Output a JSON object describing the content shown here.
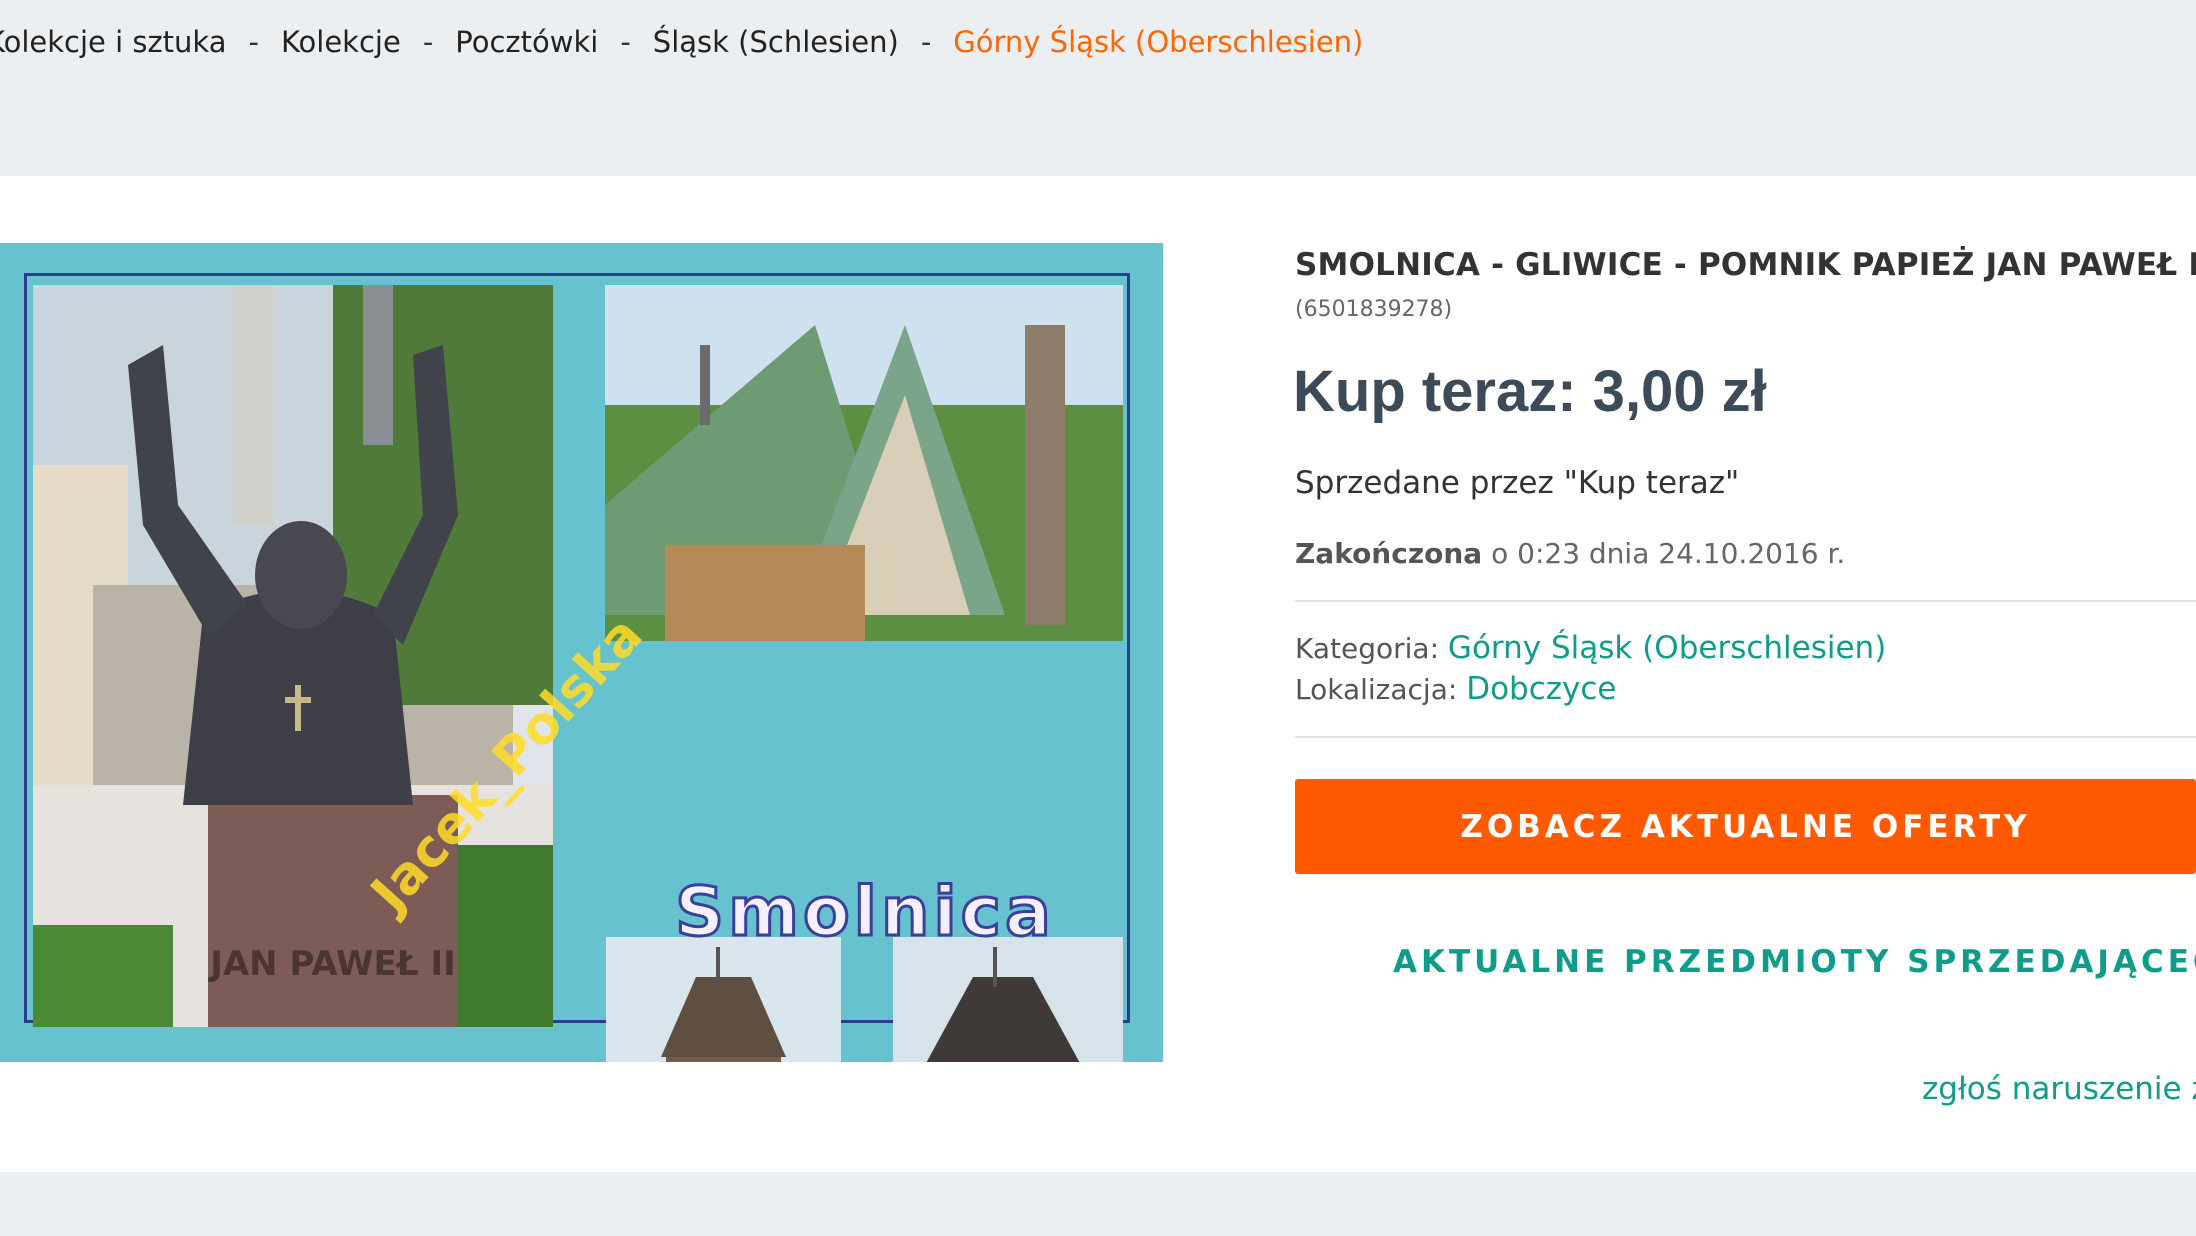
{
  "breadcrumb": {
    "items": [
      {
        "label": "Kolekcje i sztuka"
      },
      {
        "label": "Kolekcje"
      },
      {
        "label": "Pocztówki"
      },
      {
        "label": "Śląsk (Schlesien)"
      },
      {
        "label": "Górny Śląsk (Oberschlesien)"
      }
    ],
    "separator": "-"
  },
  "postcard": {
    "title_text": "Smolnica",
    "watermark_text": "Jacek_Polska",
    "plaque_text": "JAN PAWEŁ II"
  },
  "item": {
    "title": "SMOLNICA - GLIWICE - POMNIK PAPIEŻ JAN PAWEŁ II -",
    "id": "(6501839278)",
    "price": "Kup teraz: 3,00 zł",
    "sold_by": "Sprzedane przez \"Kup teraz\"",
    "ended_label": "Zakończona",
    "ended_rest": " o 0:23 dnia 24.10.2016 r.",
    "category_label": "Kategoria: ",
    "category_value": "Górny Śląsk (Oberschlesien)",
    "location_label": "Lokalizacja: ",
    "location_value": "Dobczyce"
  },
  "actions": {
    "primary": "ZOBACZ AKTUALNE OFERTY",
    "secondary": "AKTUALNE PRZEDMIOTY SPRZEDAJĄCEGO",
    "report": "zgłoś naruszenie zasad"
  },
  "colors": {
    "accent_orange": "#ff5a00",
    "link_teal": "#0f9d8a",
    "page_bg": "#eceff2",
    "price_text": "#3d4a57"
  }
}
